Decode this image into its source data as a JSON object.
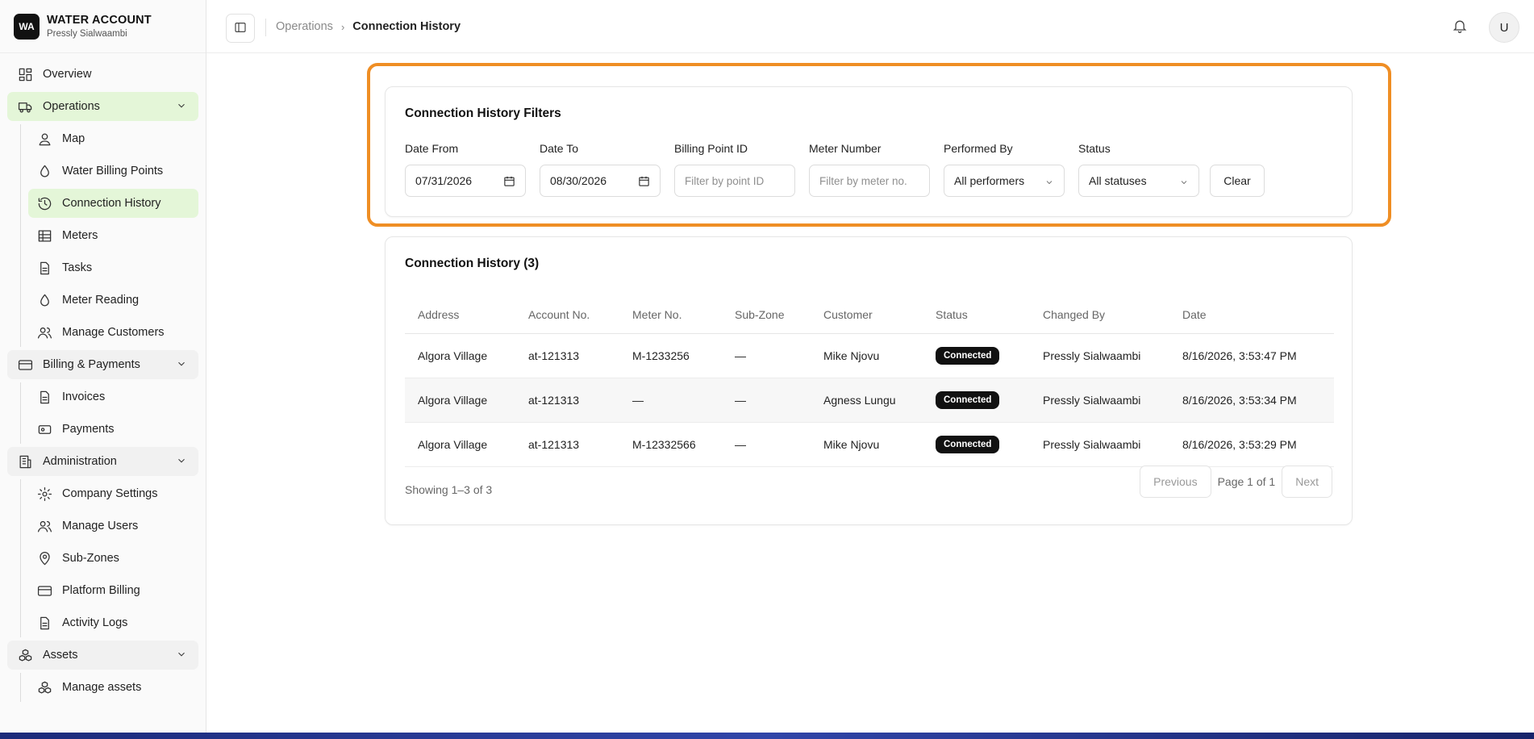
{
  "brand": {
    "logo": "WA",
    "title": "WATER ACCOUNT",
    "subtitle": "Pressly Sialwaambi"
  },
  "sidebar": {
    "overview": "Overview",
    "operations": {
      "label": "Operations",
      "items": [
        "Map",
        "Water Billing Points",
        "Connection History",
        "Meters",
        "Tasks",
        "Meter Reading",
        "Manage Customers"
      ]
    },
    "billing": {
      "label": "Billing & Payments",
      "items": [
        "Invoices",
        "Payments"
      ]
    },
    "administration": {
      "label": "Administration",
      "items": [
        "Company Settings",
        "Manage Users",
        "Sub-Zones",
        "Platform Billing",
        "Activity Logs"
      ]
    },
    "assets": {
      "label": "Assets",
      "items": [
        "Manage assets"
      ]
    }
  },
  "topbar": {
    "breadcrumb_parent": "Operations",
    "breadcrumb_current": "Connection History",
    "avatar": "U"
  },
  "filters": {
    "title": "Connection History Filters",
    "date_from_label": "Date From",
    "date_from_value": "07/31/2026",
    "date_to_label": "Date To",
    "date_to_value": "08/30/2026",
    "billing_point_label": "Billing Point ID",
    "billing_point_placeholder": "Filter by point ID",
    "meter_label": "Meter Number",
    "meter_placeholder": "Filter by meter no.",
    "performed_by_label": "Performed By",
    "performed_by_value": "All performers",
    "status_label": "Status",
    "status_value": "All statuses",
    "clear": "Clear"
  },
  "history": {
    "title": "Connection History (3)",
    "columns": [
      "Address",
      "Account No.",
      "Meter No.",
      "Sub-Zone",
      "Customer",
      "Status",
      "Changed By",
      "Date"
    ],
    "rows": [
      [
        "Algora Village",
        "at-121313",
        "M-1233256",
        "—",
        "Mike Njovu",
        "Connected",
        "Pressly Sialwaambi",
        "8/16/2026, 3:53:47 PM"
      ],
      [
        "Algora Village",
        "at-121313",
        "—",
        "—",
        "Agness Lungu",
        "Connected",
        "Pressly Sialwaambi",
        "8/16/2026, 3:53:34 PM"
      ],
      [
        "Algora Village",
        "at-121313",
        "M-12332566",
        "—",
        "Mike Njovu",
        "Connected",
        "Pressly Sialwaambi",
        "8/16/2026, 3:53:29 PM"
      ]
    ],
    "showing": "Showing 1–3 of 3",
    "previous": "Previous",
    "page_info": "Page 1 of 1",
    "next": "Next"
  },
  "colors": {
    "highlight": "#ef8e24",
    "active_nav": "#e4f6d8",
    "badge": "#111111"
  }
}
